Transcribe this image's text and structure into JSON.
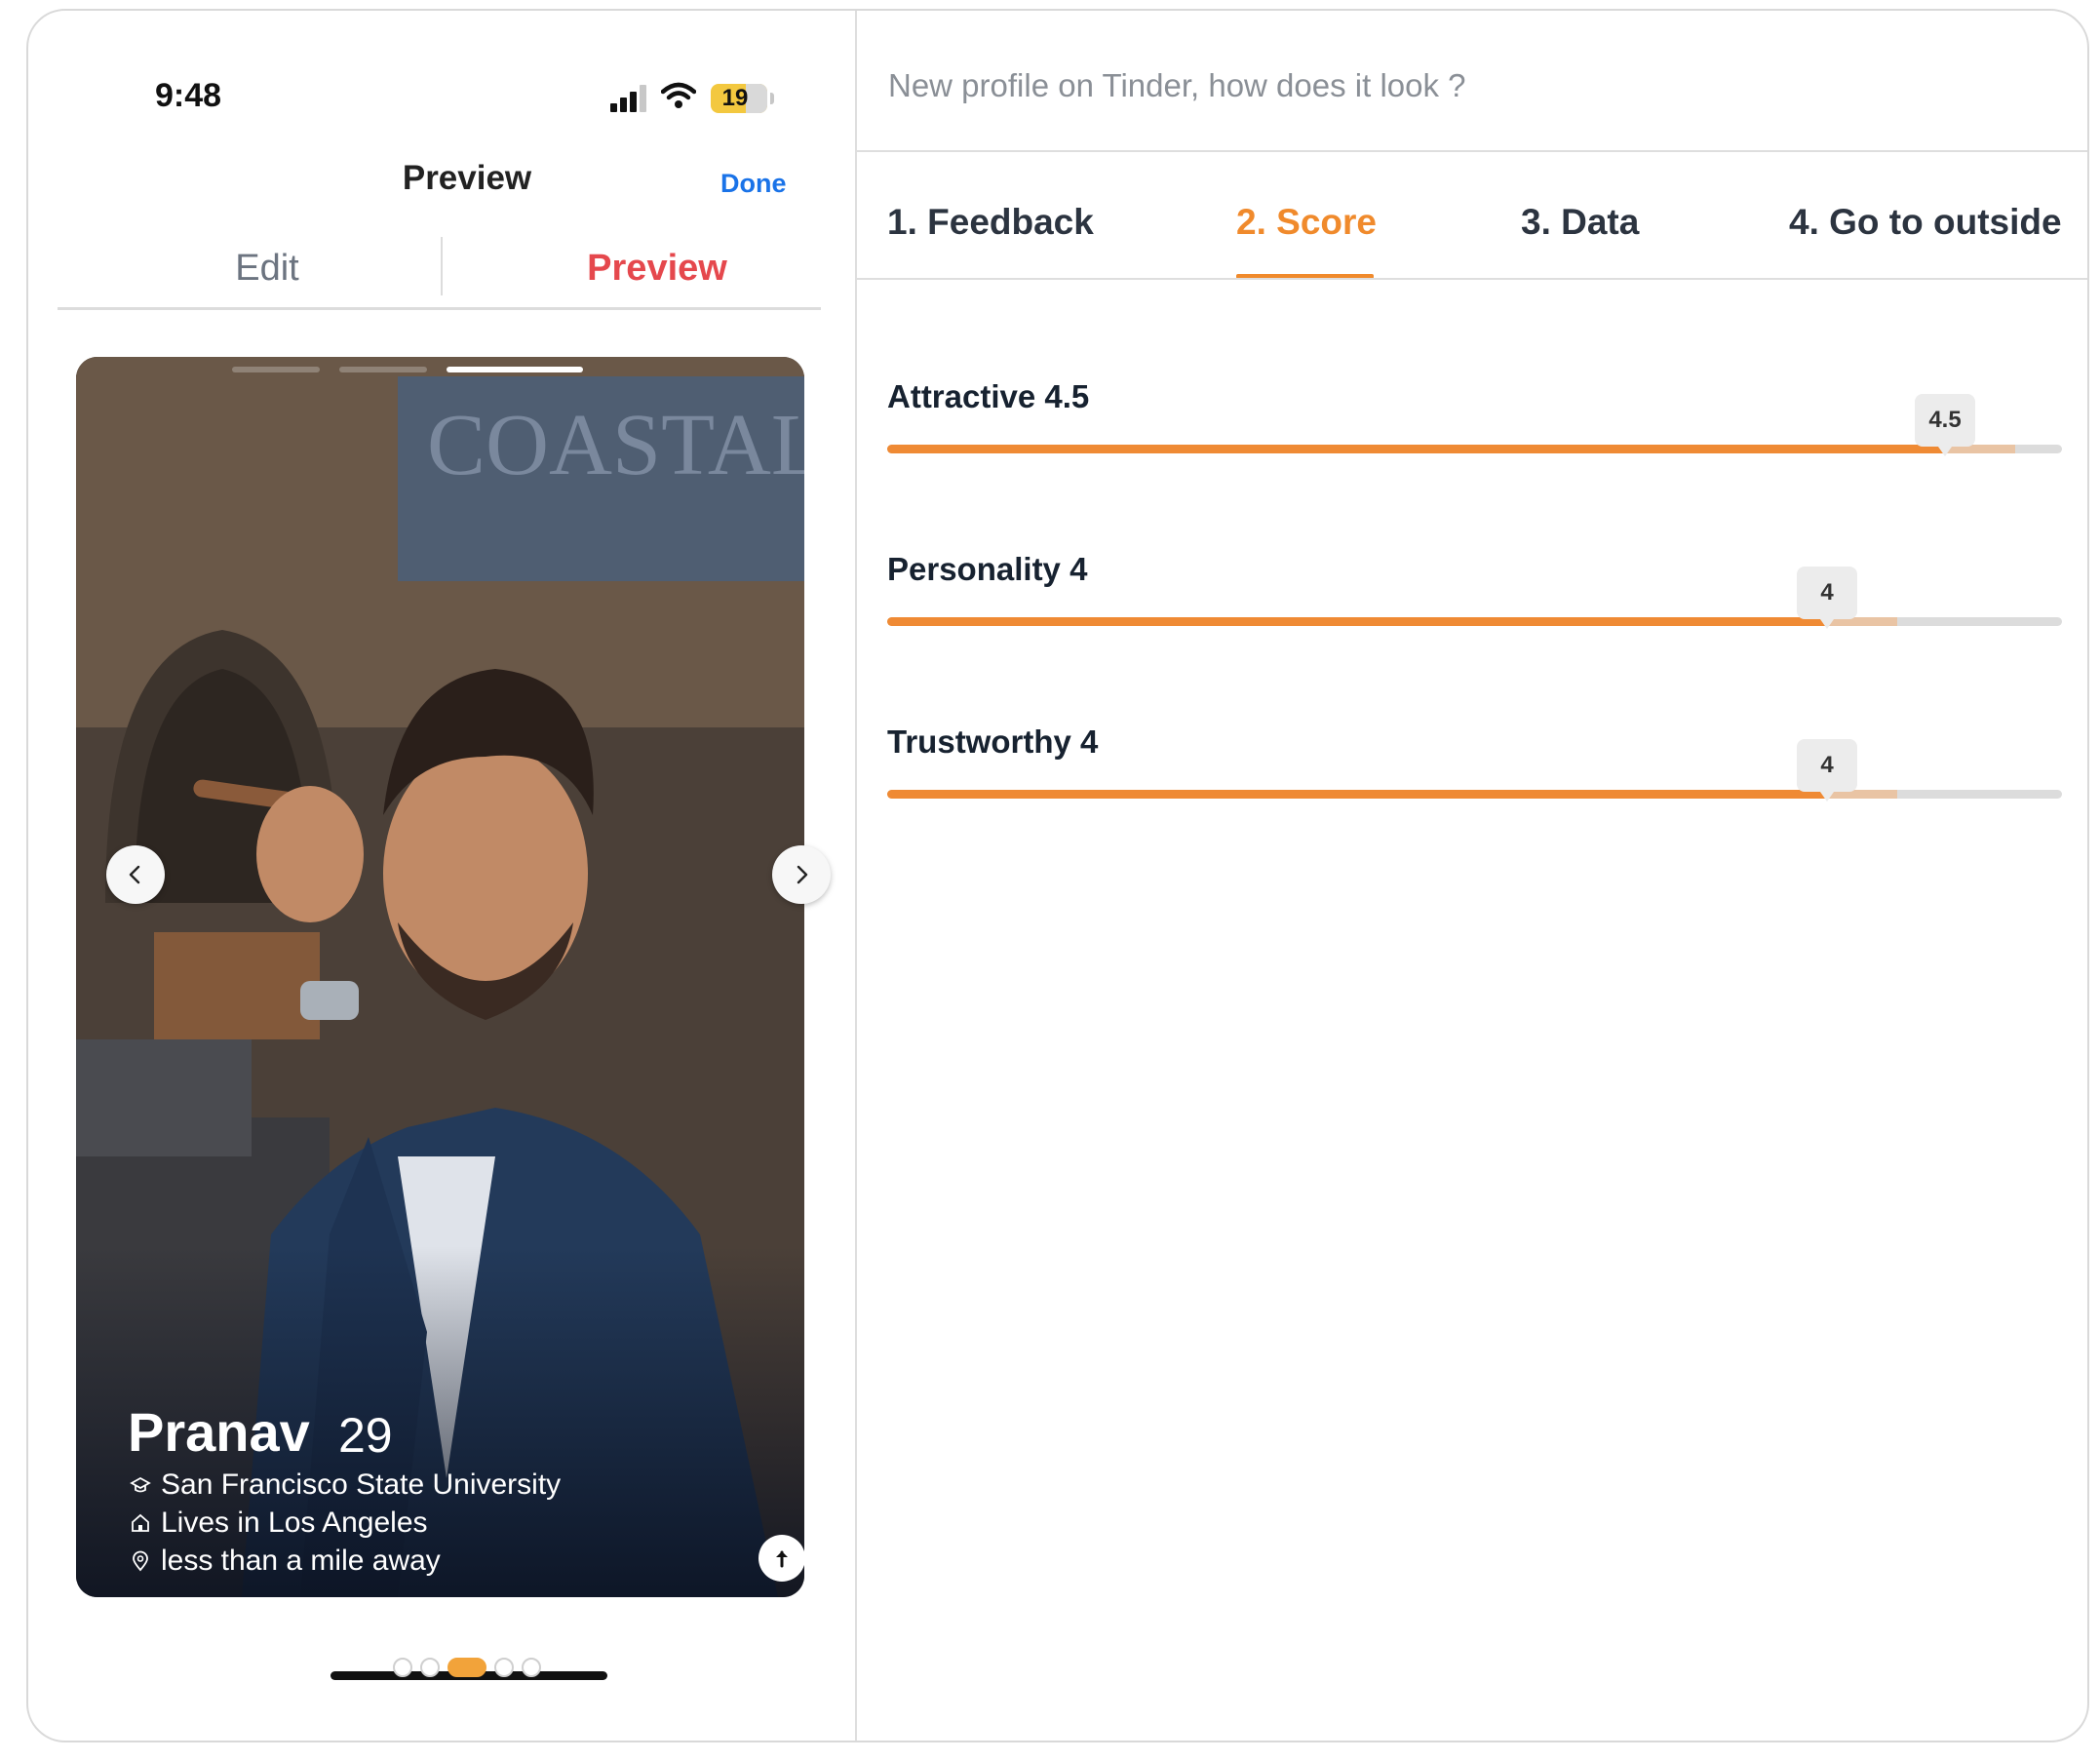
{
  "status_bar": {
    "time": "9:48",
    "battery": "19"
  },
  "phone_nav": {
    "title": "Preview",
    "done_label": "Done"
  },
  "segments": {
    "edit": "Edit",
    "preview": "Preview",
    "selected": "Preview"
  },
  "profile": {
    "name": "Pranav",
    "age": "29",
    "school": "San Francisco State University",
    "lives": "Lives in Los Angeles",
    "distance": "less than a mile away",
    "photo_count": 5,
    "current_photo_index": 3
  },
  "post": {
    "title": "New profile on Tinder, how does it look ?"
  },
  "tabs": [
    {
      "label": "1. Feedback",
      "active": false
    },
    {
      "label": "2. Score",
      "active": true
    },
    {
      "label": "3. Data",
      "active": false
    },
    {
      "label": "4. Go to outside",
      "active": false
    }
  ],
  "scores": [
    {
      "label": "Attractive 4.5",
      "value": 4.5,
      "bubble": "4.5",
      "max": 5
    },
    {
      "label": "Personality 4",
      "value": 4,
      "bubble": "4",
      "max": 5
    },
    {
      "label": "Trustworthy 4",
      "value": 4,
      "bubble": "4",
      "max": 5
    }
  ],
  "colors": {
    "accent": "#ef8a34",
    "preview_red": "#e5484d",
    "done_blue": "#1a73e8"
  }
}
